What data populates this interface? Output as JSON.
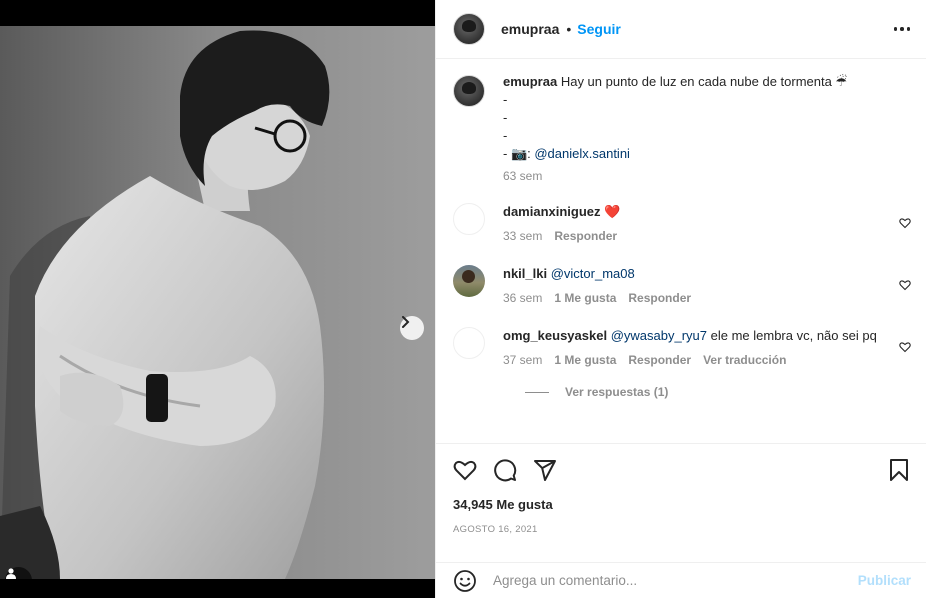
{
  "post": {
    "username": "emupraa",
    "separator": "•",
    "follow_label": "Seguir",
    "caption_line1": "Hay un punto de luz en cada nube de tormenta ☔",
    "caption_dash": "-",
    "caption_last_prefix": "- 📷: ",
    "caption_mention": "@danielx.santini",
    "caption_time": "63 sem"
  },
  "comments": [
    {
      "username": "damianxiniguez",
      "text": "❤️",
      "time": "33 sem",
      "likes": "",
      "reply": "Responder",
      "translate": ""
    },
    {
      "username": "nkil_lki",
      "mention": "@victor_ma08",
      "text": "",
      "time": "36 sem",
      "likes": "1 Me gusta",
      "reply": "Responder",
      "translate": ""
    },
    {
      "username": "omg_keusyaskel",
      "mention": "@ywasaby_ryu7",
      "text": " ele me lembra vc, não sei pq",
      "time": "37 sem",
      "likes": "1 Me gusta",
      "reply": "Responder",
      "translate": "Ver traducción"
    }
  ],
  "view_replies": "Ver respuestas (1)",
  "likes_count": "34,945 Me gusta",
  "date": "AGOSTO 16, 2021",
  "composer": {
    "placeholder": "Agrega un comentario...",
    "post_label": "Publicar"
  },
  "colors": {
    "accent": "#0095f6",
    "link": "#00376b",
    "muted": "#8e8e8e",
    "heart": "#ed4956"
  },
  "icons": [
    "more-icon",
    "heart-icon",
    "comment-icon",
    "share-icon",
    "bookmark-icon",
    "emoji-icon",
    "chevron-right-icon",
    "user-tag-icon"
  ]
}
